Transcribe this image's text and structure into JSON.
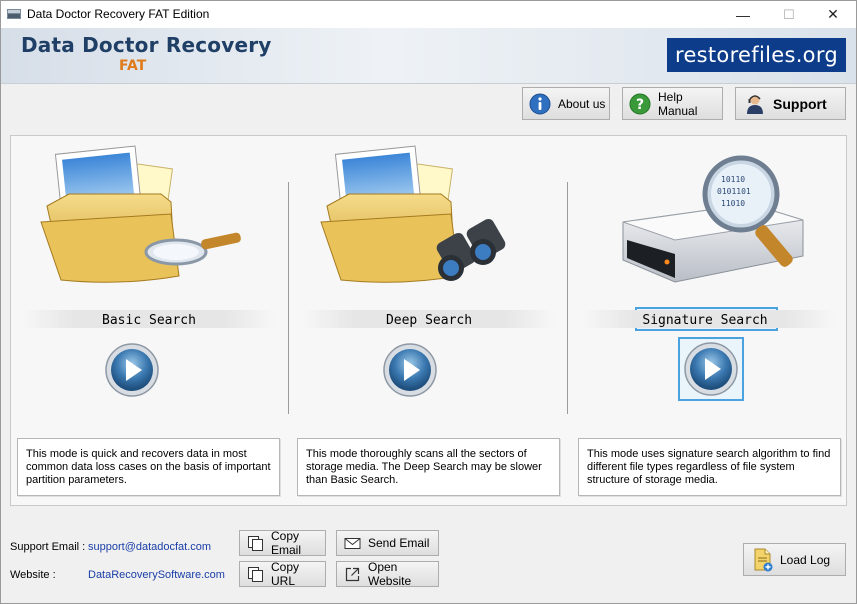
{
  "window": {
    "title": "Data Doctor Recovery FAT Edition",
    "minimize_glyph": "—",
    "maximize_glyph": "☐",
    "close_glyph": "✕"
  },
  "header": {
    "brand_title": "Data Doctor Recovery",
    "brand_subtitle": "FAT",
    "site_logo": "restorefiles.org"
  },
  "toolbar": {
    "about_label": "About us",
    "help_label": "Help Manual",
    "support_label": "Support"
  },
  "modes": [
    {
      "label": "Basic Search",
      "description": "This mode is quick and recovers data in most common data loss cases on the basis of important partition parameters.",
      "icon": "folder-magnifier-icon"
    },
    {
      "label": "Deep Search",
      "description": "This mode thoroughly scans all the sectors of storage media. The Deep Search may be slower than Basic Search.",
      "icon": "folder-binoculars-icon"
    },
    {
      "label": "Signature Search",
      "description": "This mode uses signature search algorithm to find different file types regardless of file system structure of storage media.",
      "icon": "harddrive-magnifier-icon",
      "selected": true
    }
  ],
  "footer": {
    "support_email_label": "Support Email :",
    "support_email": "support@datadocfat.com",
    "website_label": "Website :",
    "website": "DataRecoverySoftware.com",
    "copy_email_label": "Copy Email",
    "send_email_label": "Send Email",
    "copy_url_label": "Copy URL",
    "open_website_label": "Open Website",
    "load_log_label": "Load Log"
  },
  "colors": {
    "brand_blue": "#1f3f66",
    "brand_orange": "#e07a1a",
    "logo_bg": "#0d3c8a",
    "selection": "#4aa3df",
    "link": "#1a3ea8"
  }
}
